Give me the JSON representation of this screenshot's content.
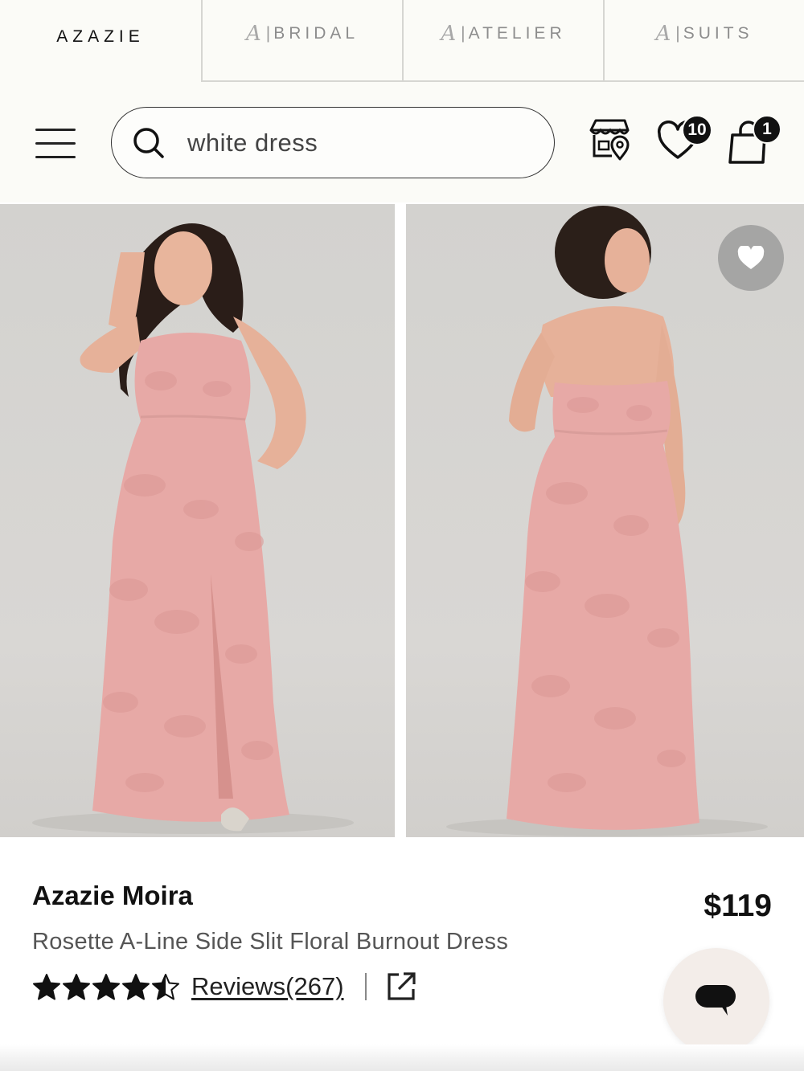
{
  "brand_tabs": [
    {
      "label": "AZAZIE",
      "active": true
    },
    {
      "label": "BRIDAL",
      "active": false
    },
    {
      "label": "ATELIER",
      "active": false
    },
    {
      "label": "SUITS",
      "active": false
    }
  ],
  "brand_mark": "A",
  "brand_separator": "|",
  "search": {
    "value": "white dress",
    "icon": "search-icon"
  },
  "header_icons": {
    "store": "store-locator-icon",
    "wishlist": "heart-icon",
    "wishlist_count": "10",
    "cart": "shopping-bag-icon",
    "cart_count": "1"
  },
  "product": {
    "name": "Azazie Moira",
    "description": "Rosette A-Line Side Slit Floral Burnout Dress",
    "price": "$119",
    "rating": 4.5,
    "reviews_label": "Reviews(267)",
    "dress_color": "#e7a9a6"
  },
  "colors": {
    "header_bg": "#fbfbf7",
    "text": "#111111",
    "subtext": "#555555",
    "badge": "#111111",
    "chat_bg": "#f3ede9"
  }
}
